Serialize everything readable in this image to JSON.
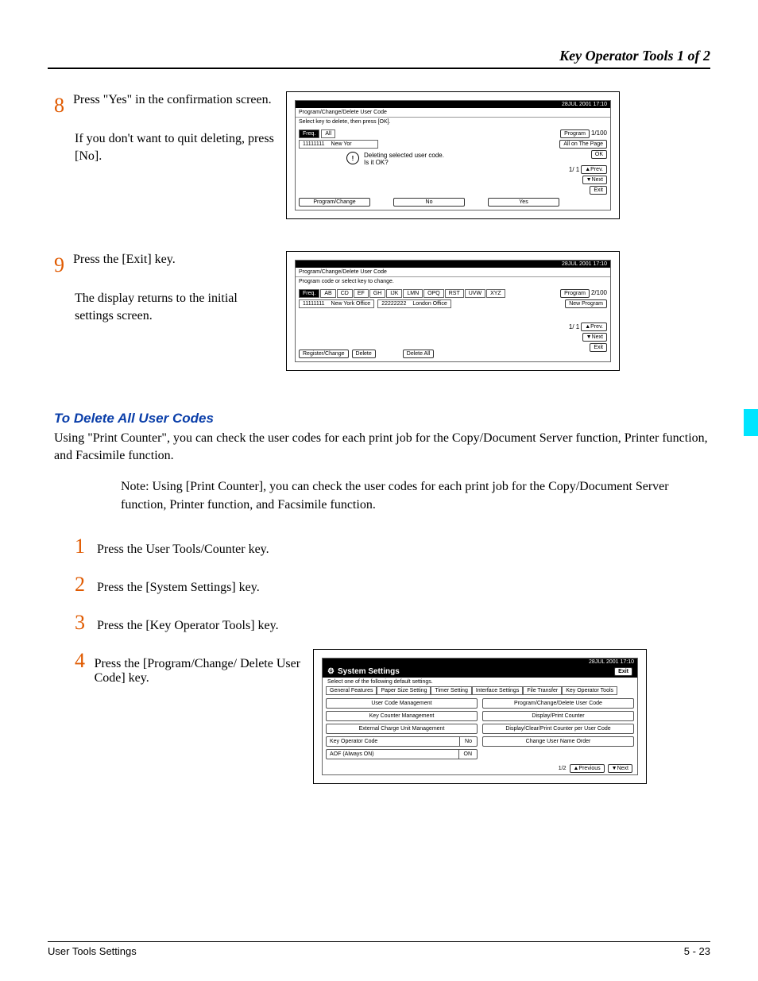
{
  "header": {
    "title": "Key Operator Tools 1 of 2"
  },
  "step8": {
    "num": "8",
    "main": "Press \"Yes\" in the confirmation screen.",
    "sub": "If you don't want to quit deleting, press [No].",
    "ui": {
      "timestamp": "28JUL 2001 17:10",
      "caption": "Program/Change/Delete User Code",
      "subcaption": "Select key to delete, then press [OK].",
      "tab_freq": "Freq.",
      "tab_all": "All",
      "row_code": "11111111",
      "row_name": "New Yor",
      "msg1": "Deleting selected user code.",
      "msg2": "Is it OK?",
      "btn_no": "No",
      "btn_yes": "Yes",
      "btn_progchg": "Program/Change",
      "r_program": "Program",
      "r_page": "1/100",
      "r_allpage": "All on The Page",
      "r_ok": "OK",
      "r_11": "1/ 1",
      "r_prev": "▲Prev.",
      "r_next": "▼Next",
      "r_exit": "Exit"
    }
  },
  "step9": {
    "num": "9",
    "main": "Press the [Exit] key.",
    "sub": "The display returns to the initial settings screen.",
    "ui": {
      "timestamp": "28JUL 2001 17:10",
      "caption": "Program/Change/Delete User Code",
      "subcaption": "Program code or select key to change.",
      "tabs": [
        "Freq.",
        "AB",
        "CD",
        "EF",
        "GH",
        "IJK",
        "LMN",
        "OPQ",
        "RST",
        "UVW",
        "XYZ"
      ],
      "row1_code": "11111111",
      "row1_name": "New York Office",
      "row2_code": "22222222",
      "row2_name": "London Office",
      "btn_regchg": "Register/Change",
      "btn_delete": "Delete",
      "btn_delall": "Delete All",
      "r_program": "Program",
      "r_page": "2/100",
      "r_newprog": "New Program",
      "r_11": "1/ 1",
      "r_prev": "▲Prev.",
      "r_next": "▼Next",
      "r_exit": "Exit"
    }
  },
  "section": {
    "head": "To Delete All User Codes",
    "para": "Using \"Print Counter\", you can check the user codes for each print job for the Copy/Document Server function, Printer function, and Facsimile function.",
    "note": "Note:  Using [Print Counter], you can check the user codes for each print job for the Copy/Document Server function, Printer function, and Facsimile function."
  },
  "steps": {
    "s1": {
      "num": "1",
      "txt": "Press the User Tools/Counter key."
    },
    "s2": {
      "num": "2",
      "txt": "Press the [System Settings] key."
    },
    "s3": {
      "num": "3",
      "txt": "Press the [Key Operator Tools] key."
    },
    "s4": {
      "num": "4",
      "txt": "Press the [Program/Change/ Delete User Code] key."
    }
  },
  "sysset": {
    "timestamp": "28JUL 2001 17:10",
    "title": "System Settings",
    "exit": "Exit",
    "sub": "Select one of the following default settings.",
    "tabs": [
      "General Features",
      "Paper Size Setting",
      "Timer Setting",
      "Interface Settings",
      "File Transfer",
      "Key Operator Tools"
    ],
    "left": {
      "r1": "User Code Management",
      "r2": "Key Counter Management",
      "r3": "External Charge Unit Management",
      "r4_lbl": "Key Operator Code",
      "r4_val": "No",
      "r5_lbl": "AOF (Always ON)",
      "r5_val": "ON"
    },
    "right": {
      "r1": "Program/Change/Delete User Code",
      "r2": "Display/Print Counter",
      "r3": "Display/Clear/Print Counter per User Code",
      "r4": "Change User Name Order"
    },
    "foot_page": "1/2",
    "foot_prev": "▲Previous",
    "foot_next": "▼Next"
  },
  "footer": {
    "left": "User Tools Settings",
    "right": "5 - 23"
  }
}
